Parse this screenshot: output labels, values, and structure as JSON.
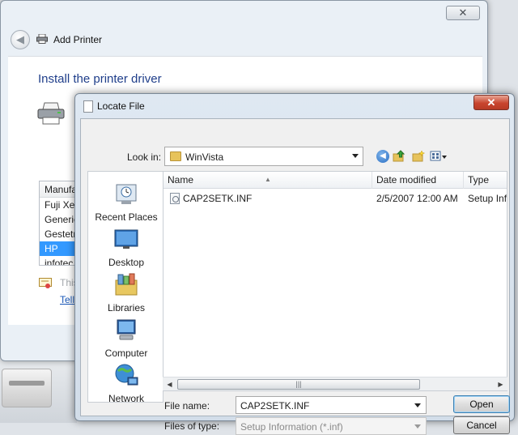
{
  "wizard": {
    "title": "Add Printer",
    "heading": "Install the printer driver",
    "list_header": "Manufacturer",
    "list_items": [
      "Fuji Xerox",
      "Generic",
      "Gestetner",
      "HP",
      "infotec"
    ],
    "selected_item": "HP",
    "this_text": "This",
    "tell_link": "Tell",
    "close_glyph": "✕"
  },
  "dialog": {
    "title": "Locate File",
    "close_glyph": "✕",
    "look_in_label": "Look in:",
    "look_in_value": "WinVista",
    "places": [
      {
        "label": "Recent Places",
        "icon": "recent-places-icon"
      },
      {
        "label": "Desktop",
        "icon": "desktop-icon"
      },
      {
        "label": "Libraries",
        "icon": "libraries-icon"
      },
      {
        "label": "Computer",
        "icon": "computer-icon"
      },
      {
        "label": "Network",
        "icon": "network-icon"
      }
    ],
    "columns": {
      "name": "Name",
      "date_modified": "Date modified",
      "type": "Type"
    },
    "files": [
      {
        "name": "CAP2SETK.INF",
        "date_modified": "2/5/2007 12:00 AM",
        "type": "Setup Information"
      }
    ],
    "file_name_label": "File name:",
    "file_name_value": "CAP2SETK.INF",
    "files_of_type_label": "Files of type:",
    "files_of_type_value": "Setup Information (*.inf)",
    "open_button": "Open",
    "cancel_button": "Cancel"
  },
  "colors": {
    "selection": "#3399ff",
    "heading_blue": "#1f3e8a",
    "close_red": "#c8452f"
  }
}
